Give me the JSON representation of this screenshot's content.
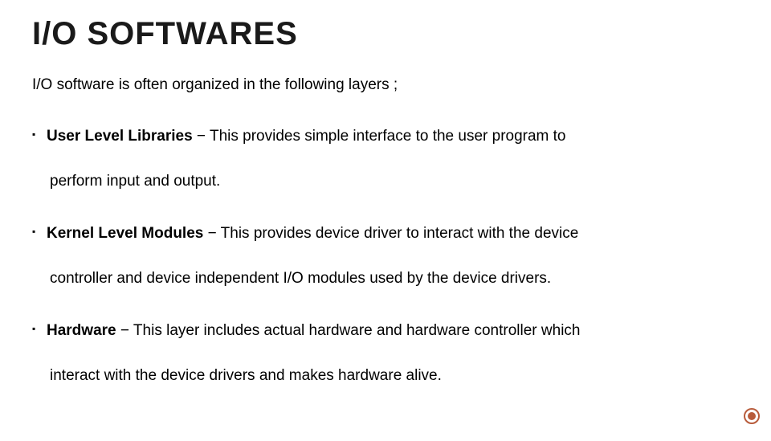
{
  "title": "I/O SOFTWARES",
  "intro": "I/O software is often organized in the following layers ;",
  "bullets": [
    {
      "term": "User Level Libraries",
      "desc": " − This provides simple interface to the user program to",
      "cont": "perform input and output."
    },
    {
      "term": "Kernel Level Modules",
      "desc": " − This provides device driver to interact with the device",
      "cont": "controller and device independent I/O modules used by the device drivers."
    },
    {
      "term": "Hardware",
      "desc": " − This layer includes actual hardware and hardware controller which",
      "cont": "interact with the device drivers and makes hardware alive."
    }
  ]
}
